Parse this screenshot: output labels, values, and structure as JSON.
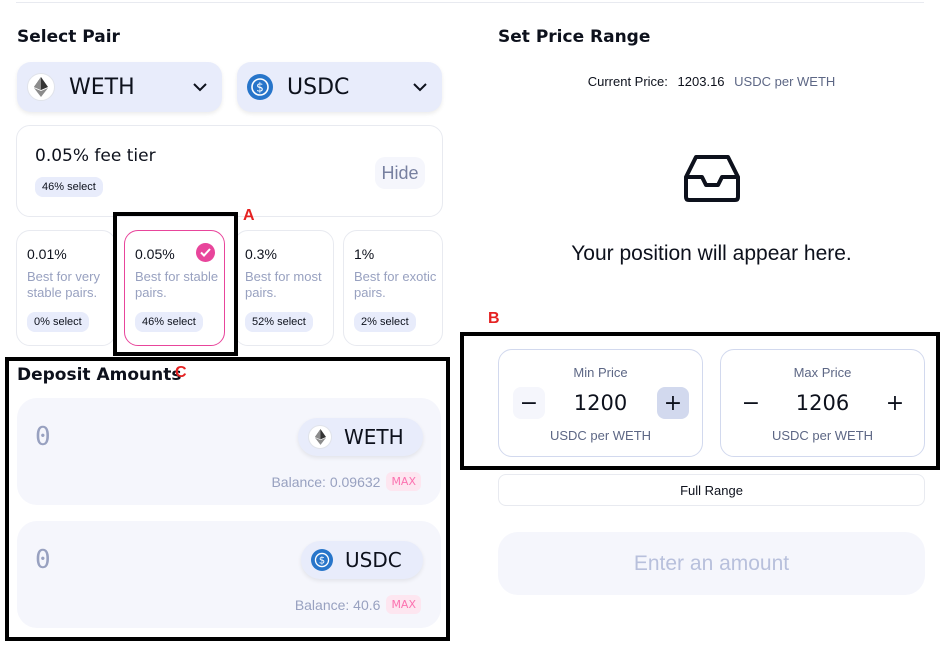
{
  "select_pair": {
    "title": "Select Pair",
    "token_a": {
      "symbol": "WETH",
      "icon": "ethereum-icon"
    },
    "token_b": {
      "symbol": "USDC",
      "icon": "usdc-icon"
    }
  },
  "fee_tier": {
    "selected_label": "0.05% fee tier",
    "selected_pct": "46% select",
    "hide_label": "Hide",
    "options": [
      {
        "pct": "0.01%",
        "desc": "Best for very stable pairs.",
        "select": "0% select",
        "selected": false
      },
      {
        "pct": "0.05%",
        "desc": "Best for stable pairs.",
        "select": "46% select",
        "selected": true
      },
      {
        "pct": "0.3%",
        "desc": "Best for most pairs.",
        "select": "52% select",
        "selected": false
      },
      {
        "pct": "1%",
        "desc": "Best for exotic pairs.",
        "select": "2% select",
        "selected": false
      }
    ]
  },
  "annotations": {
    "a": "A",
    "b": "B",
    "c": "C"
  },
  "deposit": {
    "title": "Deposit Amounts",
    "max_label": "MAX",
    "inputs": [
      {
        "value": "0",
        "symbol": "WETH",
        "balance": "Balance: 0.09632"
      },
      {
        "value": "0",
        "symbol": "USDC",
        "balance": "Balance: 40.6"
      }
    ]
  },
  "price_range": {
    "title": "Set Price Range",
    "current_price_label": "Current Price:",
    "current_price_value": "1203.16",
    "current_price_unit": "USDC per WETH",
    "empty_message": "Your position will appear here.",
    "min": {
      "label": "Min Price",
      "value": "1200",
      "unit": "USDC per WETH"
    },
    "max": {
      "label": "Max Price",
      "value": "1206",
      "unit": "USDC per WETH"
    },
    "full_range_label": "Full Range",
    "submit_label": "Enter an amount"
  },
  "colors": {
    "accent_pink": "#fc72b0",
    "select_pink": "#e8459b",
    "annotation_red": "#e52222",
    "usdc_blue": "#2775ca"
  }
}
